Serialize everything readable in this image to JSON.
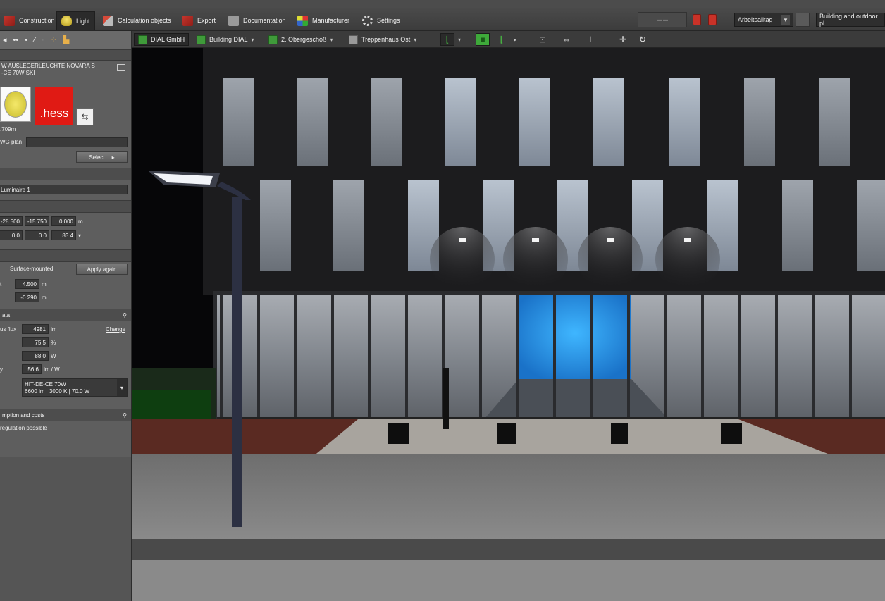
{
  "menu": {
    "items": [
      {
        "label": "Construction",
        "icon": "construction-icon"
      },
      {
        "label": "Light",
        "icon": "light-icon"
      },
      {
        "label": "Calculation objects",
        "icon": "calculation-icon"
      },
      {
        "label": "Export",
        "icon": "export-icon"
      },
      {
        "label": "Documentation",
        "icon": "documentation-icon"
      },
      {
        "label": "Manufacturer",
        "icon": "manufacturer-icon"
      },
      {
        "label": "Settings",
        "icon": "gear-icon"
      }
    ],
    "scene_select": "Arbeitsalltag",
    "view_select": "Building and outdoor pl"
  },
  "breadcrumb": {
    "items": [
      {
        "label": "DIAL GmbH"
      },
      {
        "label": "Building DIAL"
      },
      {
        "label": "2. Obergeschoß"
      },
      {
        "label": "Treppenhaus Ost"
      }
    ]
  },
  "panel": {
    "luminaire_name_line1": "W AUSLEGERLEUCHTE NOVARA S",
    "luminaire_name_line2": "-CE 70W SKI",
    "distance": ".709m",
    "brand": ".hess",
    "dwg_plan_label": "WG plan",
    "select_label": "Select",
    "object_name": "Luminaire 1",
    "position": {
      "x": "-28.500",
      "y": "-15.750",
      "z": "0.000",
      "unit": "m"
    },
    "rotation": {
      "a": "0.0",
      "b": "0.0",
      "c": "83.4"
    },
    "mounting": {
      "mode": "Surface-mounted",
      "apply_label": "Apply again",
      "height_label": "t",
      "height": "4.500",
      "height_unit": "m",
      "offset": "-0.290",
      "offset_unit": "m"
    },
    "data_header": "ata",
    "data": {
      "flux_label": "us flux",
      "flux": "4981",
      "flux_unit": "lm",
      "change_label": "Change",
      "lor": "75.5",
      "lor_unit": "%",
      "power": "88.0",
      "power_unit": "W",
      "eff_label": "y",
      "efficacy": "56.6",
      "efficacy_unit": "lm / W",
      "lamp_line1": "HIT-DE-CE 70W",
      "lamp_line2": "6600 lm  |  3000 K  |  70.0 W"
    },
    "costs_header": "mption and costs",
    "regulation": "regulation possible"
  }
}
